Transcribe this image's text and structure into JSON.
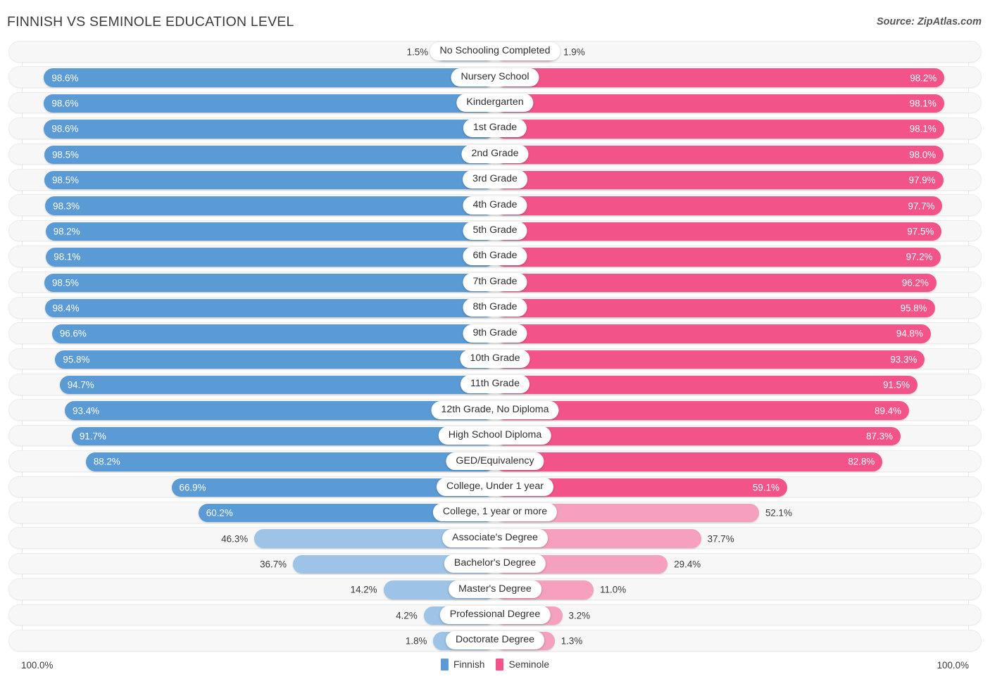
{
  "header": {
    "title": "FINNISH VS SEMINOLE EDUCATION LEVEL",
    "source": "Source: ZipAtlas.com"
  },
  "legend": {
    "left": {
      "label": "Finnish",
      "color": "#5B9BD5"
    },
    "right": {
      "label": "Seminole",
      "color": "#F2548A"
    }
  },
  "axis": {
    "left_max": "100.0%",
    "right_max": "100.0%"
  },
  "colors": {
    "blue_strong": "#5B9BD5",
    "blue_light": "#9DC3E6",
    "pink_strong": "#F2548A",
    "pink_light": "#F4A0BE",
    "track": "#f7f7f7"
  },
  "chart_data": {
    "type": "bar",
    "orientation": "horizontal-diverging",
    "title": "FINNISH VS SEMINOLE EDUCATION LEVEL",
    "xlabel": "",
    "ylabel": "",
    "xlim": [
      0,
      100
    ],
    "grid": true,
    "legend_position": "bottom-center",
    "categories": [
      "No Schooling Completed",
      "Nursery School",
      "Kindergarten",
      "1st Grade",
      "2nd Grade",
      "3rd Grade",
      "4th Grade",
      "5th Grade",
      "6th Grade",
      "7th Grade",
      "8th Grade",
      "9th Grade",
      "10th Grade",
      "11th Grade",
      "12th Grade, No Diploma",
      "High School Diploma",
      "GED/Equivalency",
      "College, Under 1 year",
      "College, 1 year or more",
      "Associate's Degree",
      "Bachelor's Degree",
      "Master's Degree",
      "Professional Degree",
      "Doctorate Degree"
    ],
    "series": [
      {
        "name": "Finnish",
        "color": "#5B9BD5",
        "values": [
          1.5,
          98.6,
          98.6,
          98.6,
          98.5,
          98.5,
          98.3,
          98.2,
          98.1,
          98.5,
          98.4,
          96.6,
          95.8,
          94.7,
          93.4,
          91.7,
          88.2,
          66.9,
          60.2,
          46.3,
          36.7,
          14.2,
          4.2,
          1.8
        ],
        "labels": [
          "1.5%",
          "98.6%",
          "98.6%",
          "98.6%",
          "98.5%",
          "98.5%",
          "98.3%",
          "98.2%",
          "98.1%",
          "98.5%",
          "98.4%",
          "96.6%",
          "95.8%",
          "94.7%",
          "93.4%",
          "91.7%",
          "88.2%",
          "66.9%",
          "60.2%",
          "46.3%",
          "36.7%",
          "14.2%",
          "4.2%",
          "1.8%"
        ]
      },
      {
        "name": "Seminole",
        "color": "#F2548A",
        "values": [
          1.9,
          98.2,
          98.1,
          98.1,
          98.0,
          97.9,
          97.7,
          97.5,
          97.2,
          96.2,
          95.8,
          94.8,
          93.3,
          91.5,
          89.4,
          87.3,
          82.8,
          59.1,
          52.1,
          37.7,
          29.4,
          11.0,
          3.2,
          1.3
        ],
        "labels": [
          "1.9%",
          "98.2%",
          "98.1%",
          "98.1%",
          "98.0%",
          "97.9%",
          "97.7%",
          "97.5%",
          "97.2%",
          "96.2%",
          "95.8%",
          "94.8%",
          "93.3%",
          "91.5%",
          "89.4%",
          "87.3%",
          "82.8%",
          "59.1%",
          "52.1%",
          "37.7%",
          "29.4%",
          "11.0%",
          "3.2%",
          "1.3%"
        ]
      }
    ]
  }
}
